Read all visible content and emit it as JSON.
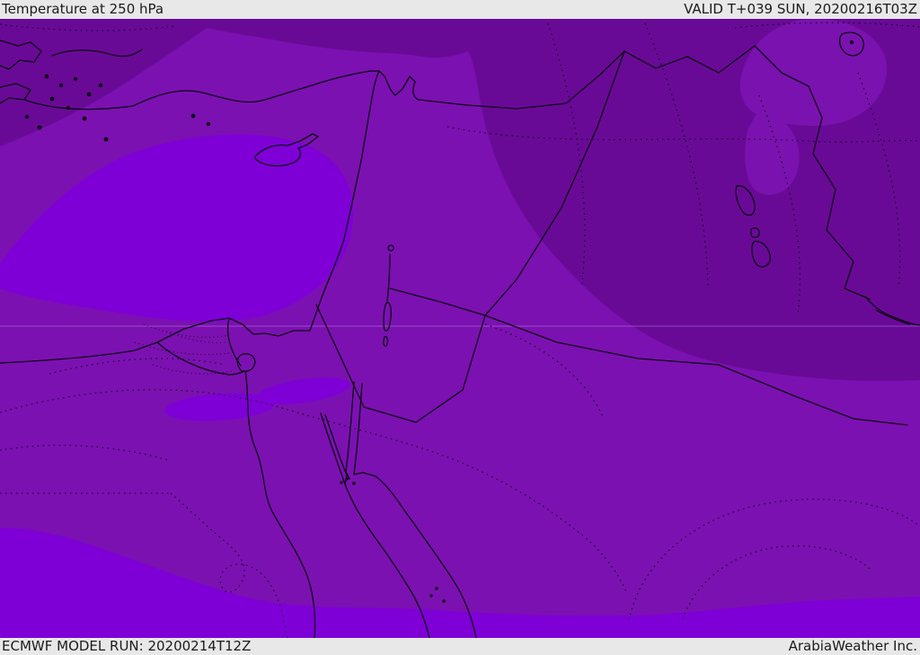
{
  "header": {
    "title": "Temperature at 250 hPa",
    "valid": "VALID T+039 SUN, 20200216T03Z"
  },
  "footer": {
    "model_run": "ECMWF MODEL RUN: 20200214T12Z",
    "credit": "ArabiaWeather Inc."
  },
  "map": {
    "parameter": "Temperature",
    "level": "250 hPa",
    "colors": {
      "base_band": "#7b11b1",
      "cold_band": "#690a97",
      "inner_patch": "#7a12af",
      "warm_band": "#7e00d6",
      "line": "#0d0314",
      "graticule": "#e3c8ff",
      "chrome_bg": "#e8e8e8",
      "chrome_text": "#1b1b1b"
    },
    "regions": {
      "cold_airmass": "cold-shade-north-and-east",
      "base": "base-temperature-shade",
      "warm_pool": "warm-shade-east-mediterranean",
      "warm_south_band": "warm-shade-southern-band"
    }
  }
}
